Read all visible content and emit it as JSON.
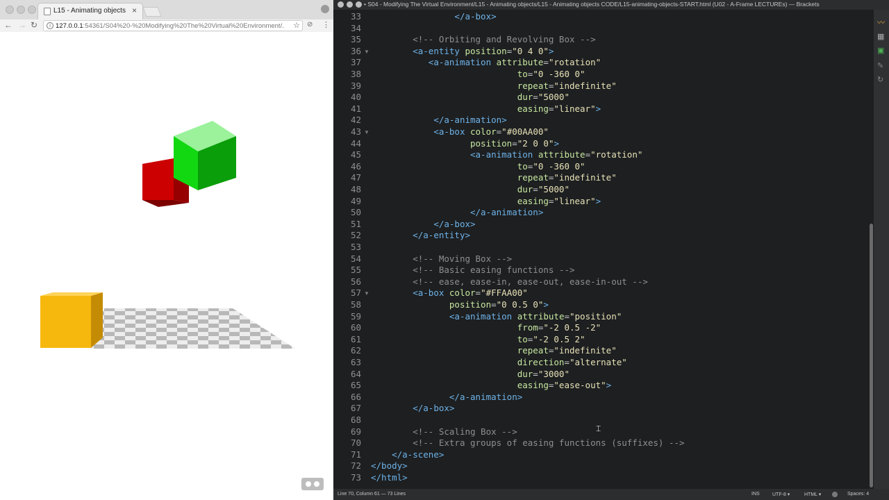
{
  "browser": {
    "tab_title": "L15 - Animating objects",
    "tab_close": "×",
    "url_prefix": "127.0.0.1",
    "url_rest": ":54361/S04%20-%20Modifying%20The%20Virtual%20Environment/...",
    "icons": {
      "back": "←",
      "forward": "→",
      "reload": "↻",
      "star": "☆",
      "menu": "⋮",
      "info": "i",
      "extension": "⊘"
    }
  },
  "scene": {
    "green_color": "#12d812",
    "red_color": "#cc0000",
    "yellow_color": "#f7b80e"
  },
  "editor": {
    "title": "• S04 - Modifying The Virtual Environment/L15 - Animating objects/L15 - Animating objects CODE/L15-animating-objects-START.html (U02 - A-Frame LECTUREs) — Brackets",
    "lines": [
      {
        "n": "33",
        "fold": false,
        "segs": [
          [
            "                ",
            "p"
          ],
          [
            "</a-box>",
            "t"
          ]
        ]
      },
      {
        "n": "34",
        "fold": false,
        "segs": []
      },
      {
        "n": "35",
        "fold": false,
        "segs": [
          [
            "        ",
            "p"
          ],
          [
            "<!-- Orbiting and Revolving Box -->",
            "c"
          ]
        ]
      },
      {
        "n": "36",
        "fold": true,
        "segs": [
          [
            "        ",
            "p"
          ],
          [
            "<a-entity ",
            "t"
          ],
          [
            "position",
            "a"
          ],
          [
            "=",
            "p"
          ],
          [
            "\"0 4 0\"",
            "s"
          ],
          [
            ">",
            "t"
          ]
        ]
      },
      {
        "n": "37",
        "fold": false,
        "segs": [
          [
            "           ",
            "p"
          ],
          [
            "<a-animation ",
            "t"
          ],
          [
            "attribute",
            "a"
          ],
          [
            "=",
            "p"
          ],
          [
            "\"rotation\"",
            "s"
          ]
        ]
      },
      {
        "n": "38",
        "fold": false,
        "segs": [
          [
            "                            ",
            "p"
          ],
          [
            "to",
            "a"
          ],
          [
            "=",
            "p"
          ],
          [
            "\"0 -360 0\"",
            "s"
          ]
        ]
      },
      {
        "n": "39",
        "fold": false,
        "segs": [
          [
            "                            ",
            "p"
          ],
          [
            "repeat",
            "a"
          ],
          [
            "=",
            "p"
          ],
          [
            "\"indefinite\"",
            "s"
          ]
        ]
      },
      {
        "n": "40",
        "fold": false,
        "segs": [
          [
            "                            ",
            "p"
          ],
          [
            "dur",
            "a"
          ],
          [
            "=",
            "p"
          ],
          [
            "\"5000\"",
            "s"
          ]
        ]
      },
      {
        "n": "41",
        "fold": false,
        "segs": [
          [
            "                            ",
            "p"
          ],
          [
            "easing",
            "a"
          ],
          [
            "=",
            "p"
          ],
          [
            "\"linear\"",
            "s"
          ],
          [
            ">",
            "t"
          ]
        ]
      },
      {
        "n": "42",
        "fold": false,
        "segs": [
          [
            "            ",
            "p"
          ],
          [
            "</a-animation>",
            "t"
          ]
        ]
      },
      {
        "n": "43",
        "fold": true,
        "segs": [
          [
            "            ",
            "p"
          ],
          [
            "<a-box ",
            "t"
          ],
          [
            "color",
            "a"
          ],
          [
            "=",
            "p"
          ],
          [
            "\"#00AA00\"",
            "s"
          ]
        ]
      },
      {
        "n": "44",
        "fold": false,
        "segs": [
          [
            "                   ",
            "p"
          ],
          [
            "position",
            "a"
          ],
          [
            "=",
            "p"
          ],
          [
            "\"2 0 0\"",
            "s"
          ],
          [
            ">",
            "t"
          ]
        ]
      },
      {
        "n": "45",
        "fold": false,
        "segs": [
          [
            "                   ",
            "p"
          ],
          [
            "<a-animation ",
            "t"
          ],
          [
            "attribute",
            "a"
          ],
          [
            "=",
            "p"
          ],
          [
            "\"rotation\"",
            "s"
          ]
        ]
      },
      {
        "n": "46",
        "fold": false,
        "segs": [
          [
            "                            ",
            "p"
          ],
          [
            "to",
            "a"
          ],
          [
            "=",
            "p"
          ],
          [
            "\"0 -360 0\"",
            "s"
          ]
        ]
      },
      {
        "n": "47",
        "fold": false,
        "segs": [
          [
            "                            ",
            "p"
          ],
          [
            "repeat",
            "a"
          ],
          [
            "=",
            "p"
          ],
          [
            "\"indefinite\"",
            "s"
          ]
        ]
      },
      {
        "n": "48",
        "fold": false,
        "segs": [
          [
            "                            ",
            "p"
          ],
          [
            "dur",
            "a"
          ],
          [
            "=",
            "p"
          ],
          [
            "\"5000\"",
            "s"
          ]
        ]
      },
      {
        "n": "49",
        "fold": false,
        "segs": [
          [
            "                            ",
            "p"
          ],
          [
            "easing",
            "a"
          ],
          [
            "=",
            "p"
          ],
          [
            "\"linear\"",
            "s"
          ],
          [
            ">",
            "t"
          ]
        ]
      },
      {
        "n": "50",
        "fold": false,
        "segs": [
          [
            "                   ",
            "p"
          ],
          [
            "</a-animation>",
            "t"
          ]
        ]
      },
      {
        "n": "51",
        "fold": false,
        "segs": [
          [
            "            ",
            "p"
          ],
          [
            "</a-box>",
            "t"
          ]
        ]
      },
      {
        "n": "52",
        "fold": false,
        "segs": [
          [
            "        ",
            "p"
          ],
          [
            "</a-entity>",
            "t"
          ]
        ]
      },
      {
        "n": "53",
        "fold": false,
        "segs": []
      },
      {
        "n": "54",
        "fold": false,
        "segs": [
          [
            "        ",
            "p"
          ],
          [
            "<!-- Moving Box -->",
            "c"
          ]
        ]
      },
      {
        "n": "55",
        "fold": false,
        "segs": [
          [
            "        ",
            "p"
          ],
          [
            "<!-- Basic easing functions -->",
            "c"
          ]
        ]
      },
      {
        "n": "56",
        "fold": false,
        "segs": [
          [
            "        ",
            "p"
          ],
          [
            "<!-- ease, ease-in, ease-out, ease-in-out -->",
            "c"
          ]
        ]
      },
      {
        "n": "57",
        "fold": true,
        "segs": [
          [
            "        ",
            "p"
          ],
          [
            "<a-box ",
            "t"
          ],
          [
            "color",
            "a"
          ],
          [
            "=",
            "p"
          ],
          [
            "\"#FFAA00\"",
            "s"
          ]
        ]
      },
      {
        "n": "58",
        "fold": false,
        "segs": [
          [
            "               ",
            "p"
          ],
          [
            "position",
            "a"
          ],
          [
            "=",
            "p"
          ],
          [
            "\"0 0.5 0\"",
            "s"
          ],
          [
            ">",
            "t"
          ]
        ]
      },
      {
        "n": "59",
        "fold": false,
        "segs": [
          [
            "               ",
            "p"
          ],
          [
            "<a-animation ",
            "t"
          ],
          [
            "attribute",
            "a"
          ],
          [
            "=",
            "p"
          ],
          [
            "\"position\"",
            "s"
          ]
        ]
      },
      {
        "n": "60",
        "fold": false,
        "segs": [
          [
            "                            ",
            "p"
          ],
          [
            "from",
            "a"
          ],
          [
            "=",
            "p"
          ],
          [
            "\"-2 0.5 -2\"",
            "s"
          ]
        ]
      },
      {
        "n": "61",
        "fold": false,
        "segs": [
          [
            "                            ",
            "p"
          ],
          [
            "to",
            "a"
          ],
          [
            "=",
            "p"
          ],
          [
            "\"-2 0.5 2\"",
            "s"
          ]
        ]
      },
      {
        "n": "62",
        "fold": false,
        "segs": [
          [
            "                            ",
            "p"
          ],
          [
            "repeat",
            "a"
          ],
          [
            "=",
            "p"
          ],
          [
            "\"indefinite\"",
            "s"
          ]
        ]
      },
      {
        "n": "63",
        "fold": false,
        "segs": [
          [
            "                            ",
            "p"
          ],
          [
            "direction",
            "a"
          ],
          [
            "=",
            "p"
          ],
          [
            "\"alternate\"",
            "s"
          ]
        ]
      },
      {
        "n": "64",
        "fold": false,
        "segs": [
          [
            "                            ",
            "p"
          ],
          [
            "dur",
            "a"
          ],
          [
            "=",
            "p"
          ],
          [
            "\"3000\"",
            "s"
          ]
        ]
      },
      {
        "n": "65",
        "fold": false,
        "segs": [
          [
            "                            ",
            "p"
          ],
          [
            "easing",
            "a"
          ],
          [
            "=",
            "p"
          ],
          [
            "\"ease-out\"",
            "s"
          ],
          [
            ">",
            "t"
          ]
        ]
      },
      {
        "n": "66",
        "fold": false,
        "segs": [
          [
            "               ",
            "p"
          ],
          [
            "</a-animation>",
            "t"
          ]
        ]
      },
      {
        "n": "67",
        "fold": false,
        "segs": [
          [
            "        ",
            "p"
          ],
          [
            "</a-box>",
            "t"
          ]
        ]
      },
      {
        "n": "68",
        "fold": false,
        "segs": []
      },
      {
        "n": "69",
        "fold": false,
        "segs": [
          [
            "        ",
            "p"
          ],
          [
            "<!-- Scaling Box -->",
            "c"
          ]
        ]
      },
      {
        "n": "70",
        "fold": false,
        "segs": [
          [
            "        ",
            "p"
          ],
          [
            "<!-- Extra groups of easing functions (suffixes) -->",
            "c"
          ]
        ]
      },
      {
        "n": "71",
        "fold": false,
        "segs": [
          [
            "    ",
            "p"
          ],
          [
            "</a-scene>",
            "t"
          ]
        ]
      },
      {
        "n": "72",
        "fold": false,
        "segs": [
          [
            "",
            "p"
          ],
          [
            "</body>",
            "t"
          ]
        ]
      },
      {
        "n": "73",
        "fold": false,
        "segs": [
          [
            "",
            "p"
          ],
          [
            "</html>",
            "t"
          ]
        ]
      }
    ],
    "status": {
      "position": "Line 70, Column 61 — 73 Lines",
      "ins": "INS",
      "encoding": "UTF-8 ▾",
      "language": "HTML ▾",
      "spaces": "Spaces: 4"
    },
    "colors": {
      "background": "#1d1f21",
      "tag": "#6fb3e8",
      "attr": "#c9e8a0",
      "string": "#e8e2b7",
      "comment": "#8f8f8f"
    }
  }
}
